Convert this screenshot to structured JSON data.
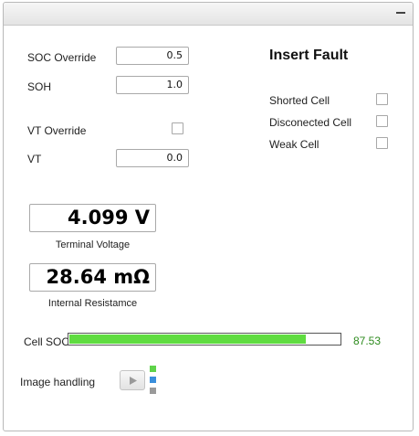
{
  "left": {
    "soc_override": {
      "label": "SOC Override",
      "value": "0.5"
    },
    "soh": {
      "label": "SOH",
      "value": "1.0"
    },
    "vt_override": {
      "label": "VT Override"
    },
    "vt": {
      "label": "VT",
      "value": "0.0"
    }
  },
  "readouts": {
    "terminal_voltage": {
      "value": "4.099 V",
      "caption": "Terminal Voltage"
    },
    "internal_resistance": {
      "value": "28.64 mΩ",
      "caption": "Internal Resistamce"
    }
  },
  "fault": {
    "title": "Insert Fault",
    "items": [
      {
        "label": "Shorted Cell"
      },
      {
        "label": "Disconected Cell"
      },
      {
        "label": "Weak Cell"
      }
    ]
  },
  "cell_soc": {
    "label": "Cell SOC",
    "value_text": "87.53",
    "percent": 87.53
  },
  "image_handling": {
    "label": "Image handling",
    "play_icon": "play-icon"
  },
  "colors": {
    "bar_fill": "#5fdc40",
    "soc_value": "#2e8b1e",
    "sq_green": "#5fd34a",
    "sq_blue": "#3a8fdc",
    "sq_gray": "#9a9a9a"
  }
}
